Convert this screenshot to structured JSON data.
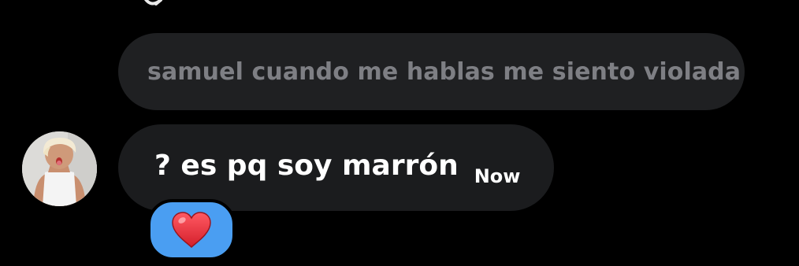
{
  "conversation": {
    "quoted_message": {
      "text": "samuel cuando me hablas me siento violada"
    },
    "message": {
      "text": "? es pq soy marrón",
      "timestamp": "Now",
      "reaction": {
        "icon": "heart-icon",
        "emoji": "❤️"
      }
    },
    "avatar": {
      "icon": "avatar"
    }
  },
  "colors": {
    "background": "#000000",
    "quoted_bubble": "#1f2022",
    "quoted_text": "#7e7f84",
    "message_bubble": "#1b1c1e",
    "message_text": "#ffffff",
    "reaction_bubble": "#4a9ef2",
    "heart": "#e8313a"
  }
}
